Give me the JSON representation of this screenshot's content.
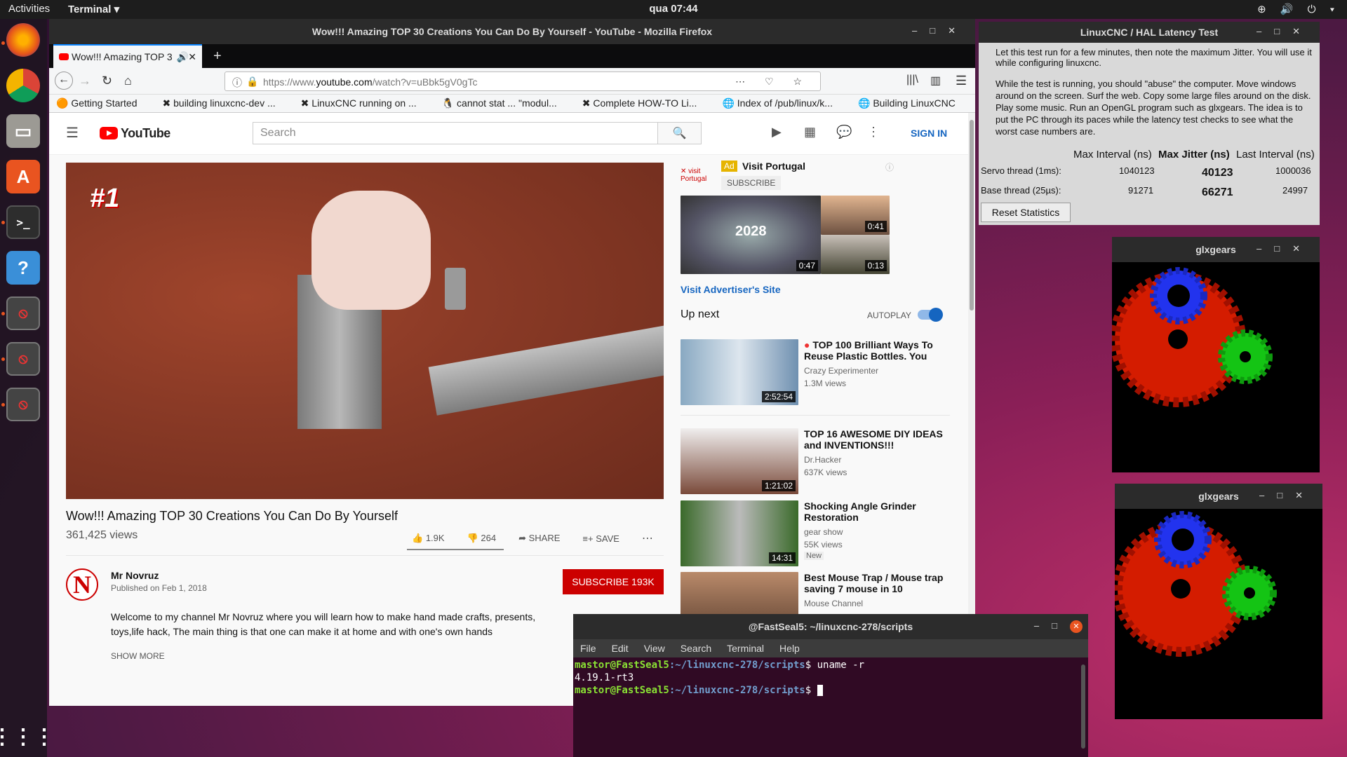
{
  "topbar": {
    "activities": "Activities",
    "app": "Terminal ▾",
    "clock": "qua 07:44",
    "tray": "⊕ 🔊 ⏻ ▾"
  },
  "firefox": {
    "title": "Wow!!! Amazing TOP 30 Creations You Can Do By Yourself - YouTube - Mozilla Firefox",
    "tab": "Wow!!! Amazing TOP 3",
    "url_prefix": "https://www.",
    "url_domain": "youtube.com",
    "url_path": "/watch?v=uBbk5gV0gTc",
    "bookmarks": [
      "Getting Started",
      "building linuxcnc-dev ...",
      "LinuxCNC running on ...",
      "cannot stat ... \"modul...",
      "Complete HOW-TO Li...",
      "Index of /pub/linux/k...",
      "Building LinuxCNC"
    ]
  },
  "youtube": {
    "logo": "YouTube",
    "search_placeholder": "Search",
    "signin": "SIGN IN",
    "badge": "#1",
    "video_title": "Wow!!! Amazing TOP 30 Creations You Can Do By Yourself",
    "views": "361,425 views",
    "likes": "1.9K",
    "dislikes": "264",
    "share": "SHARE",
    "save": "SAVE",
    "channel": "Mr Novruz",
    "published": "Published on Feb 1, 2018",
    "subscribe": "SUBSCRIBE",
    "subscribers": "193K",
    "description": "Welcome to my channel Mr Novruz where you will learn how to make hand made crafts,  presents, toys,life hack, The main thing is that one can make it at home and with one's own hands",
    "show_more": "SHOW MORE",
    "ad": {
      "badge": "Ad",
      "name": "Visit Portugal",
      "subscribe": "SUBSCRIBE",
      "big_thumb_label": "2028",
      "dur1": "0:47",
      "dur2": "0:41",
      "dur3": "0:13",
      "link": "Visit Advertiser's Site"
    },
    "up_next": "Up next",
    "autoplay": "AUTOPLAY",
    "related": [
      {
        "title": "TOP 100 Brilliant Ways To Reuse Plastic Bottles. You",
        "channel": "Crazy Experimenter",
        "views": "1.3M views",
        "duration": "2:52:54"
      },
      {
        "title": "TOP 16 AWESOME DIY IDEAS and INVENTIONS!!!",
        "channel": "Dr.Hacker",
        "views": "637K views",
        "duration": "1:21:02"
      },
      {
        "title": "Shocking Angle Grinder Restoration",
        "channel": "gear show",
        "views": "55K views",
        "duration": "14:31",
        "badge": "New"
      },
      {
        "title": "Best Mouse Trap / Mouse trap saving 7 mouse in 10",
        "channel": "Mouse Channel"
      }
    ]
  },
  "latency": {
    "title": "LinuxCNC / HAL Latency Test",
    "p1": "Let this test run for a few minutes, then note the maximum Jitter.  You will use it while configuring linuxcnc.",
    "p2": "While the test is running, you should \"abuse\" the computer. Move windows around on the screen. Surf the web. Copy some large files around on the disk. Play some music. Run an OpenGL program such as glxgears. The idea is to put the PC through its paces while the latency test checks to see what the worst case numbers are.",
    "col1": "Max Interval (ns)",
    "col2": "Max Jitter (ns)",
    "col3": "Last Interval (ns)",
    "servo_label": "Servo thread (1ms):",
    "servo_max": "1040123",
    "servo_jitter": "40123",
    "servo_last": "1000036",
    "base_label": "Base thread (25µs):",
    "base_max": "91271",
    "base_jitter": "66271",
    "base_last": "24997",
    "reset": "Reset Statistics"
  },
  "glx1": {
    "title": "glxgears"
  },
  "glx2": {
    "title": "glxgears"
  },
  "terminal": {
    "title": "@FastSeal5: ~/linuxcnc-278/scripts",
    "menu": [
      "File",
      "Edit",
      "View",
      "Search",
      "Terminal",
      "Help"
    ],
    "user": "mastor@FastSeal5",
    "path": ":~/linuxcnc-278/scripts",
    "cmd": "$ uname -r",
    "output": "4.19.1-rt3",
    "prompt": "$ "
  }
}
